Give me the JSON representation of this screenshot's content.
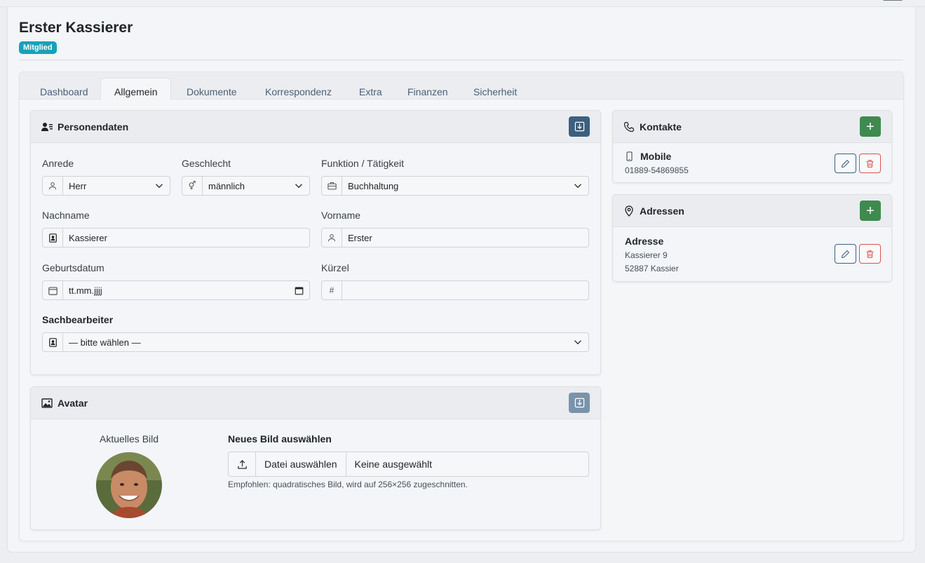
{
  "page": {
    "title": "Erster Kassierer",
    "badge": "Mitglied"
  },
  "tabs": [
    {
      "label": "Dashboard",
      "active": false
    },
    {
      "label": "Allgemein",
      "active": true
    },
    {
      "label": "Dokumente",
      "active": false
    },
    {
      "label": "Korrespondenz",
      "active": false
    },
    {
      "label": "Extra",
      "active": false
    },
    {
      "label": "Finanzen",
      "active": false
    },
    {
      "label": "Sicherheit",
      "active": false
    }
  ],
  "personal": {
    "title": "Personendaten",
    "anrede": {
      "label": "Anrede",
      "value": "Herr"
    },
    "geschlecht": {
      "label": "Geschlecht",
      "value": "männlich"
    },
    "funktion": {
      "label": "Funktion / Tätigkeit",
      "value": "Buchhaltung"
    },
    "nachname": {
      "label": "Nachname",
      "value": "Kassierer"
    },
    "vorname": {
      "label": "Vorname",
      "value": "Erster"
    },
    "geburtsdatum": {
      "label": "Geburtsdatum",
      "value": "tt.mm.jjjj"
    },
    "kuerzel": {
      "label": "Kürzel",
      "value": "",
      "addon": "#"
    },
    "sachbearbeiter": {
      "label": "Sachbearbeiter",
      "value": "— bitte wählen —"
    }
  },
  "avatar": {
    "title": "Avatar",
    "current_label": "Aktuelles Bild",
    "new_label": "Neues Bild auswählen",
    "choose_button": "Datei auswählen",
    "no_file": "Keine ausgewählt",
    "hint": "Empfohlen: quadratisches Bild, wird auf 256×256 zugeschnitten."
  },
  "contacts": {
    "title": "Kontakte",
    "items": [
      {
        "type": "Mobile",
        "value": "01889-54869855"
      }
    ]
  },
  "addresses": {
    "title": "Adressen",
    "items": [
      {
        "type": "Adresse",
        "line1": "Kassierer 9",
        "line2": "52887 Kassier"
      }
    ]
  },
  "colors": {
    "badge": "#17a2b8",
    "primary": "#3e5f7d",
    "success": "#3f8a4f",
    "danger": "#d9534f"
  }
}
